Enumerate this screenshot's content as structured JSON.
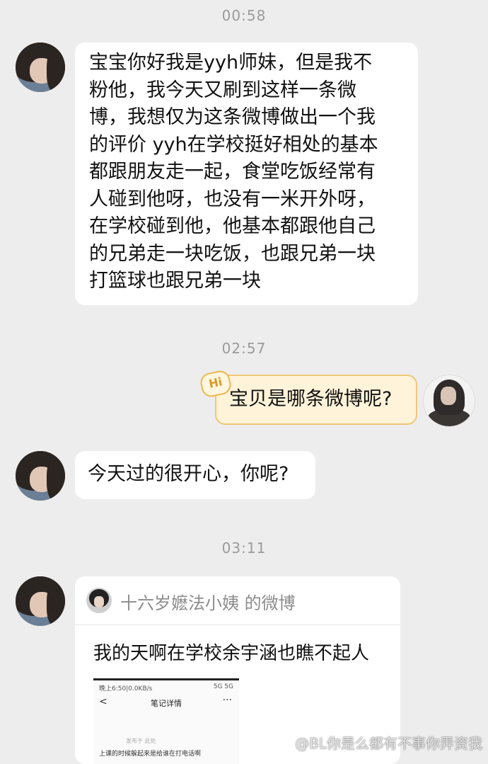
{
  "timestamps": [
    "00:58",
    "02:57",
    "03:11"
  ],
  "messages": {
    "first": {
      "lines": [
        "宝宝你好我是yyh师妹，但是我不",
        "粉他，我今天又刷到这样一条微",
        "博，我想仅为这条微博做出一个我",
        "的评价 yyh在学校挺好相处的基本",
        "都跟朋友走一起，食堂吃饭经常有",
        "人碰到他呀，也没有一米开外呀，",
        "在学校碰到他，他基本都跟他自己",
        "的兄弟走一块吃饭，也跟兄弟一块",
        "打篮球也跟兄弟一块"
      ]
    },
    "reply": {
      "badge": "Hi",
      "text": "宝贝是哪条微博呢?"
    },
    "second": {
      "text": "今天过的很开心，你呢?"
    },
    "card": {
      "source": "十六岁嬷法小姨 的微博",
      "text": "我的天啊在学校余宇涵也瞧不起人",
      "screenshot": {
        "status_left": "晚上6:50|0.0KB/s",
        "status_right": "5G 5G",
        "back": "<",
        "title": "笔记详情",
        "more": "···",
        "meta": "发布于 此处",
        "line": "上课的时候躲起来是给谁在打电话啊"
      }
    }
  },
  "watermark": "@BL你是么都有不事你弄资我",
  "colors": {
    "background": "#ededed",
    "bubble": "#ffffff",
    "mine_bubble": "#fff3d9",
    "mine_border": "#f0c676"
  }
}
